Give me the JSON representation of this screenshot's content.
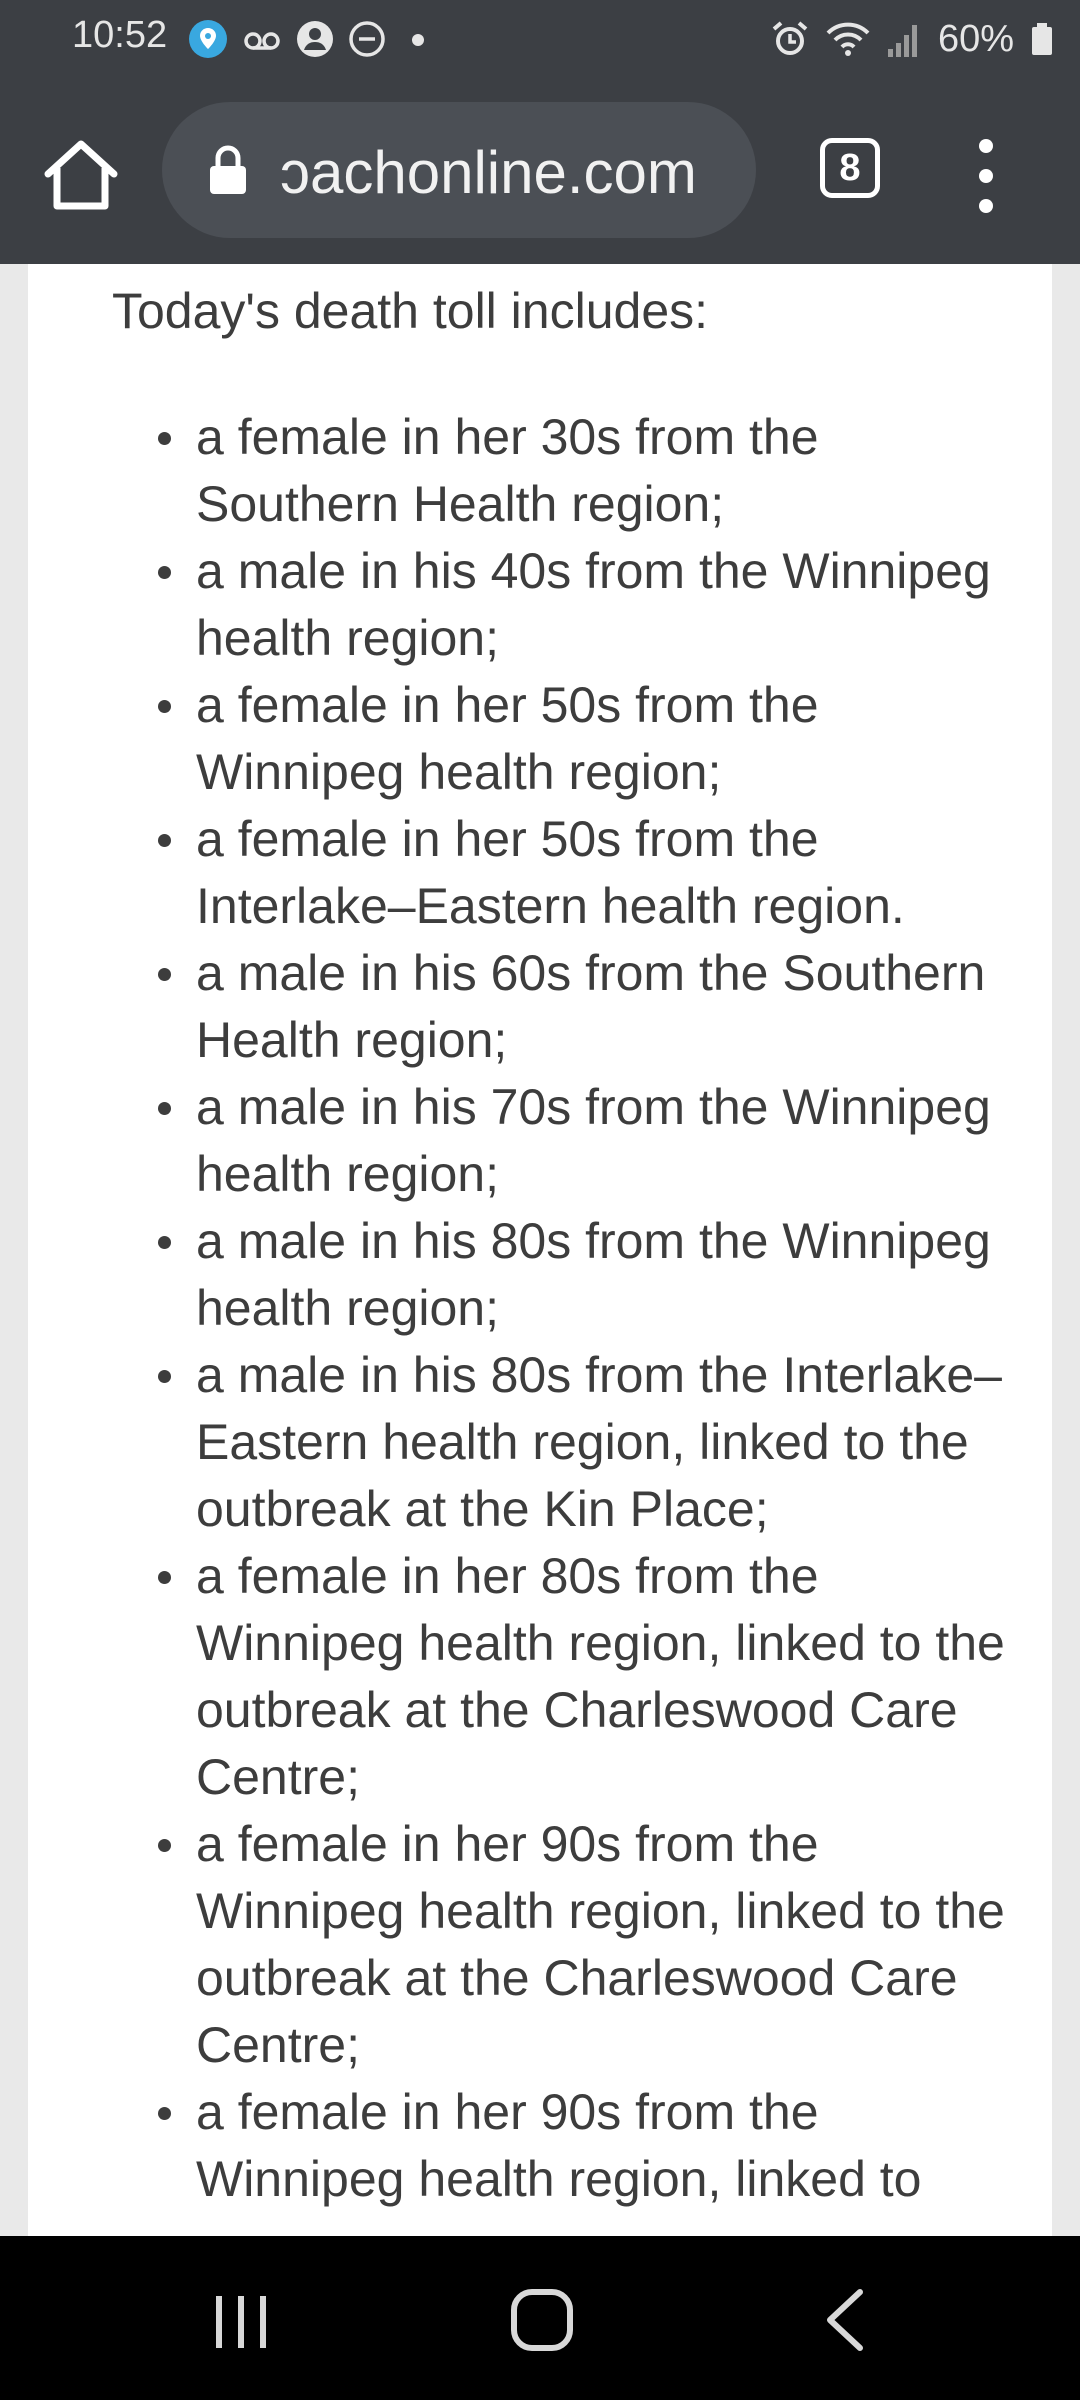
{
  "status_bar": {
    "time": "10:52",
    "battery": "60%",
    "icons_left": [
      "location-icon",
      "voicemail-icon",
      "account-icon",
      "do-not-disturb-icon",
      "dot-icon"
    ],
    "icons_right": [
      "alarm-icon",
      "wifi-icon",
      "signal-icon",
      "battery-icon"
    ]
  },
  "browser": {
    "url": "ɔachonline.com",
    "tab_count": "8"
  },
  "article": {
    "intro": "Today's death toll includes:",
    "items": [
      "a female in her 30s from the Southern Health region;",
      "a male in his 40s from the Winnipeg health region;",
      "a female in her 50s from the Winnipeg health region;",
      "a female in her 50s from the Interlake–Eastern health region.",
      "a male in his 60s from the Southern Health region;",
      "a male in his 70s from the Winnipeg health region;",
      "a male in his 80s from the Winnipeg health region;",
      "a male in his 80s from the Interlake–Eastern health region, linked to the outbreak at the Kin Place;",
      "a female in her 80s from the Winnipeg health region, linked to the outbreak at the Charleswood Care Centre;",
      "a female in her 90s from the Winnipeg health region, linked to the outbreak at the Charleswood Care Centre;",
      "a female in her 90s from the Winnipeg health region, linked to"
    ]
  },
  "colors": {
    "chrome": "#3c3f44",
    "url_pill": "#4b4f55",
    "text": "#3d3d3d",
    "page_bg": "#e9e9e9"
  }
}
